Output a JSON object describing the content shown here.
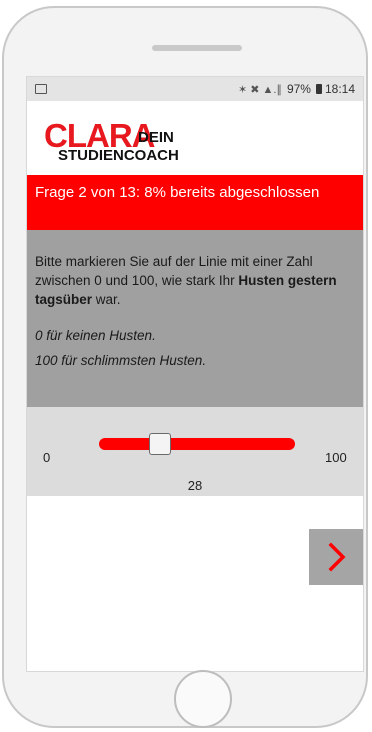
{
  "status_bar": {
    "signal_text": "✶ ✖ ▲.∥",
    "battery": "97%",
    "time": "18:14"
  },
  "logo": {
    "brand": "CLARA",
    "dein": "DEIN",
    "subtitle": "STUDIENCOACH"
  },
  "progress": {
    "text": "Frage 2 von 13: 8% bereits abgeschlossen"
  },
  "question": {
    "text_before": "Bitte markieren Sie auf der Linie mit einer Zahl zwischen 0 und 100, wie stark Ihr ",
    "text_bold": "Husten gestern tagsüber",
    "text_after": " war.",
    "hint_min": "0 für keinen Husten.",
    "hint_max": "100 für schlimmsten Husten."
  },
  "slider": {
    "min_label": "0",
    "max_label": "100",
    "value": "28"
  },
  "colors": {
    "accent": "#ff0000",
    "question_bg": "#a0a0a0",
    "slider_bg": "#dcdcdc",
    "next_button_bg": "#a5a5a5"
  },
  "icons": {
    "next": "chevron-right-icon"
  }
}
